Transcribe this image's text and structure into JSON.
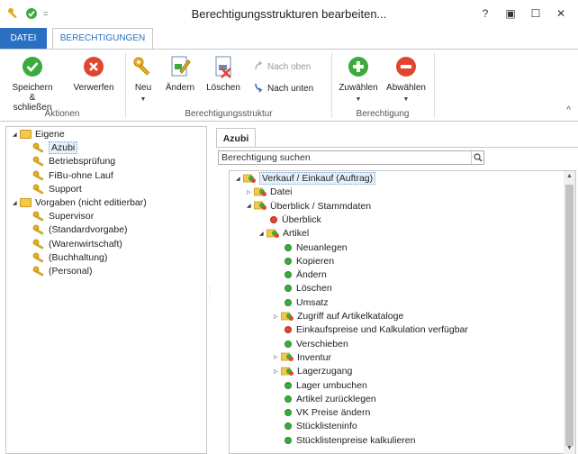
{
  "window": {
    "title": "Berechtigungsstrukturen bearbeiten...",
    "help_label": "?",
    "restore_label": "▣",
    "maximize_label": "☐",
    "close_label": "✕",
    "qa_more_label": "="
  },
  "tabs": {
    "file": "DATEI",
    "active": "BERECHTIGUNGEN"
  },
  "ribbon": {
    "actions": {
      "save_label": "Speichern & schließen",
      "discard_label": "Verwerfen",
      "group_label": "Aktionen"
    },
    "structure": {
      "new_label": "Neu",
      "edit_label": "Ändern",
      "delete_label": "Löschen",
      "up_label": "Nach oben",
      "down_label": "Nach unten",
      "group_label": "Berechtigungsstruktur"
    },
    "permission": {
      "select_label": "Zuwählen",
      "deselect_label": "Abwählen",
      "group_label": "Berechtigung"
    },
    "collapse_label": "^"
  },
  "left_tree": [
    {
      "label": "Eigene",
      "type": "folder",
      "level": 0
    },
    {
      "label": "Azubi",
      "type": "key",
      "level": 1,
      "selected": true
    },
    {
      "label": "Betriebsprüfung",
      "type": "key",
      "level": 1
    },
    {
      "label": "FiBu-ohne Lauf",
      "type": "key",
      "level": 1
    },
    {
      "label": "Support",
      "type": "key",
      "level": 1
    },
    {
      "label": "Vorgaben (nicht editierbar)",
      "type": "folder",
      "level": 0
    },
    {
      "label": "Supervisor",
      "type": "key",
      "level": 1
    },
    {
      "label": "(Standardvorgabe)",
      "type": "key",
      "level": 1
    },
    {
      "label": "(Warenwirtschaft)",
      "type": "key",
      "level": 1
    },
    {
      "label": "(Buchhaltung)",
      "type": "key",
      "level": 1
    },
    {
      "label": "(Personal)",
      "type": "key",
      "level": 1
    }
  ],
  "right": {
    "tab_label": "Azubi",
    "search_value": "Berechtigung suchen",
    "tree": [
      {
        "label": "Verkauf / Einkauf (Auftrag)",
        "type": "group",
        "level": 0,
        "expander": "open",
        "selected": true
      },
      {
        "label": "Datei",
        "type": "group",
        "level": 1,
        "expander": "closed"
      },
      {
        "label": "Überblick / Stammdaten",
        "type": "group",
        "level": 1,
        "expander": "open"
      },
      {
        "label": "Überblick",
        "type": "red",
        "level": 2
      },
      {
        "label": "Artikel",
        "type": "group",
        "level": 2,
        "expander": "open"
      },
      {
        "label": "Neuanlegen",
        "type": "green",
        "level": 3
      },
      {
        "label": "Kopieren",
        "type": "green",
        "level": 3
      },
      {
        "label": "Ändern",
        "type": "green",
        "level": 3
      },
      {
        "label": "Löschen",
        "type": "green",
        "level": 3
      },
      {
        "label": "Umsatz",
        "type": "green",
        "level": 3
      },
      {
        "label": "Zugriff auf Artikelkataloge",
        "type": "group",
        "level": 3,
        "expander": "closed"
      },
      {
        "label": "Einkaufspreise und Kalkulation verfügbar",
        "type": "red",
        "level": 3
      },
      {
        "label": "Verschieben",
        "type": "green",
        "level": 3
      },
      {
        "label": "Inventur",
        "type": "group",
        "level": 3,
        "expander": "closed"
      },
      {
        "label": "Lagerzugang",
        "type": "group",
        "level": 3,
        "expander": "closed"
      },
      {
        "label": "Lager umbuchen",
        "type": "green",
        "level": 3
      },
      {
        "label": "Artikel zurücklegen",
        "type": "green",
        "level": 3
      },
      {
        "label": "VK Preise ändern",
        "type": "green",
        "level": 3
      },
      {
        "label": "Stücklisteninfo",
        "type": "green",
        "level": 3
      },
      {
        "label": "Stücklistenpreise kalkulieren",
        "type": "green",
        "level": 3
      }
    ]
  },
  "colors": {
    "accent": "#2b6fc3",
    "green": "#3daa3d",
    "red": "#e2452f",
    "folder": "#f2c94c"
  }
}
